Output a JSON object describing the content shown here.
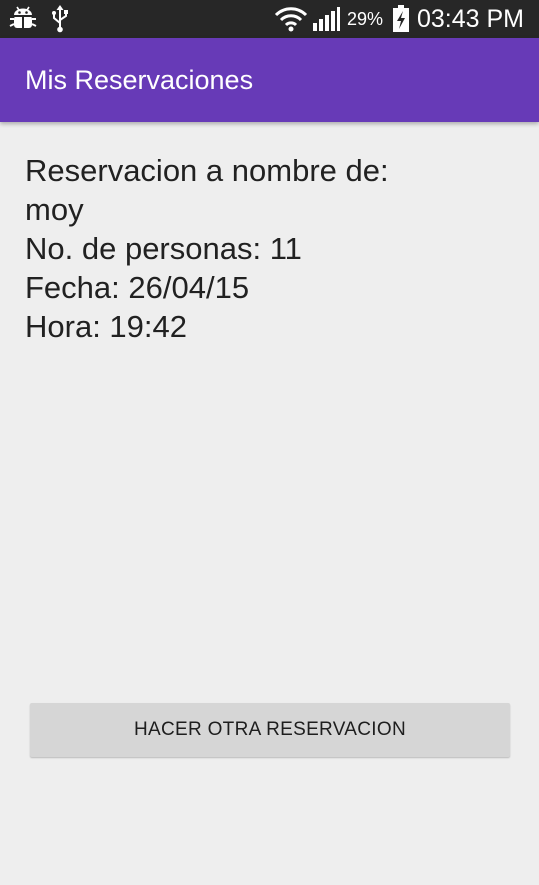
{
  "status_bar": {
    "left_icons": [
      "android-debug-icon",
      "usb-icon"
    ],
    "right_icons": [
      "wifi-icon",
      "signal-icon",
      "battery-charging-icon"
    ],
    "battery_percent": "29%",
    "battery_level": 0.29,
    "time": "03:43 PM"
  },
  "app_bar": {
    "title": "Mis Reservaciones"
  },
  "reservation": {
    "line_name_label": "Reservacion a nombre de:",
    "name": "moy",
    "persons": "No. de personas: 11",
    "date": "Fecha: 26/04/15",
    "time": "Hora: 19:42"
  },
  "actions": {
    "new_reservation_label": "HACER OTRA RESERVACION"
  },
  "colors": {
    "status_bar": "#272727",
    "app_bar": "#673ab7",
    "background": "#eeeeee",
    "button": "#d6d6d6",
    "text": "#212121"
  }
}
